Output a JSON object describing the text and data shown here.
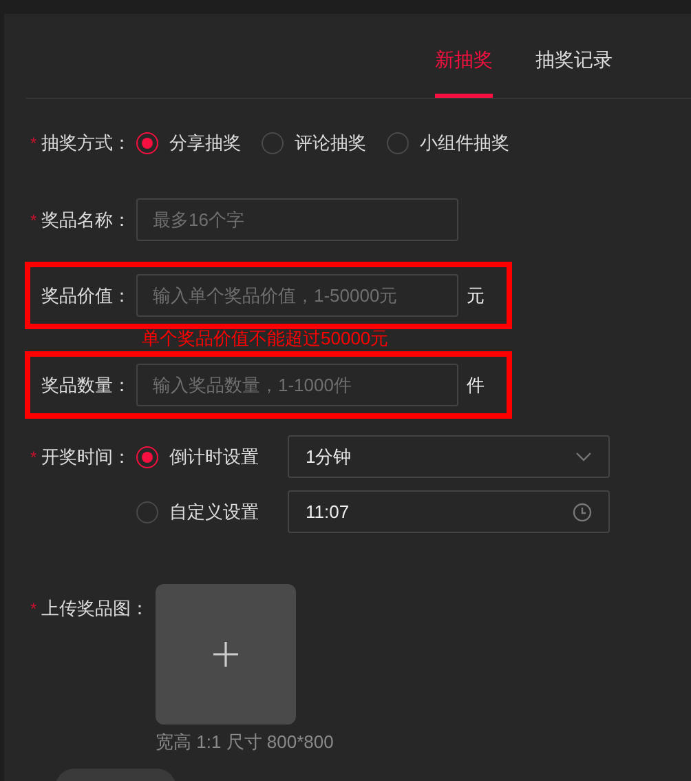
{
  "tabs": [
    {
      "label": "新抽奖",
      "selected": true
    },
    {
      "label": "抽奖记录",
      "selected": false
    }
  ],
  "form": {
    "method": {
      "label": "抽奖方式：",
      "marker": "*",
      "options": [
        {
          "label": "分享抽奖",
          "selected": true
        },
        {
          "label": "评论抽奖",
          "selected": false
        },
        {
          "label": "小组件抽奖",
          "selected": false
        }
      ]
    },
    "name": {
      "label": "奖品名称：",
      "marker": "*",
      "placeholder": "最多16个字",
      "highlighted": false
    },
    "value": {
      "label": "奖品价值：",
      "placeholder": "输入单个奖品价值，1-50000元",
      "unit": "元",
      "highlighted": true,
      "error": "单个奖品价值不能超过50000元"
    },
    "quantity": {
      "label": "奖品数量：",
      "placeholder": "输入奖品数量，1-1000件",
      "unit": "件",
      "highlighted": true
    },
    "time": {
      "label": "开奖时间：",
      "marker": "*",
      "options": [
        {
          "label": "倒计时设置",
          "selected": true,
          "kind": "select",
          "value": "1分钟"
        },
        {
          "label": "自定义设置",
          "selected": false,
          "kind": "time",
          "value": "11:07"
        }
      ]
    },
    "image": {
      "label": "上传奖品图：",
      "marker": "*",
      "hint": "宽高 1:1 尺寸 800*800"
    }
  }
}
